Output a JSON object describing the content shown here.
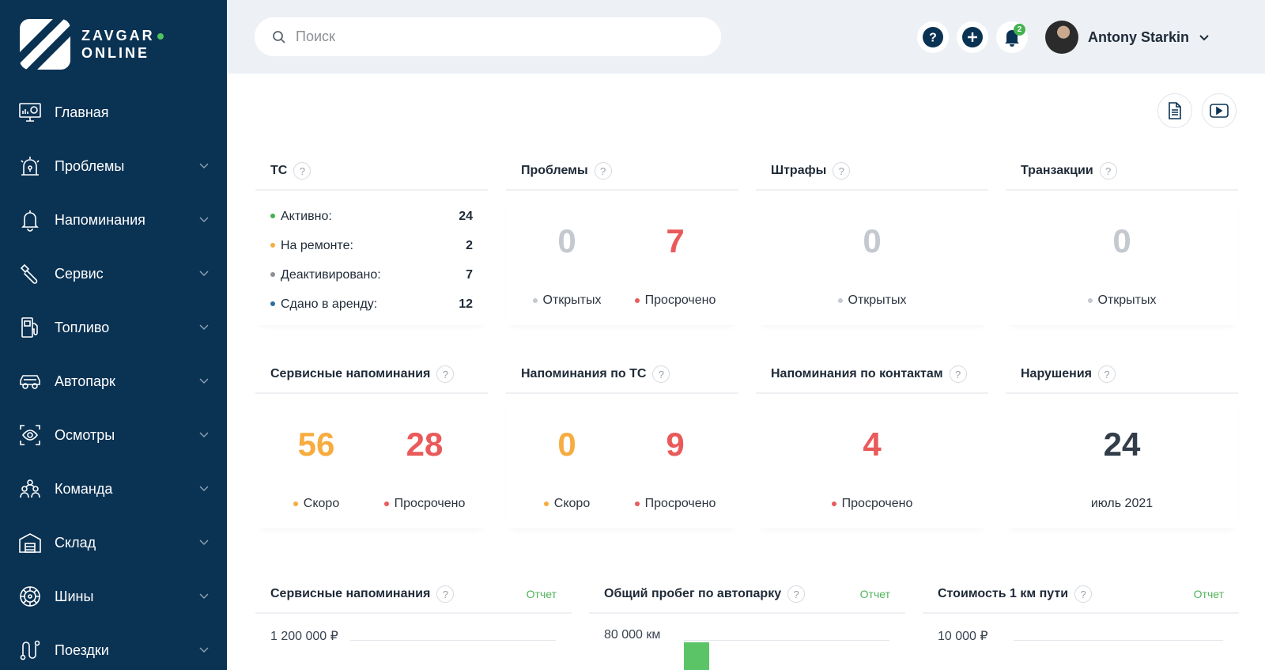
{
  "brand": {
    "line1": "ZAVGAR",
    "line2": "ONLINE",
    "accent": "#4fc45e",
    "sidebar_bg": "#0a3253"
  },
  "sidebar": {
    "items": [
      {
        "label": "Главная",
        "icon": "dashboard-icon"
      },
      {
        "label": "Проблемы",
        "icon": "alarm-icon"
      },
      {
        "label": "Напоминания",
        "icon": "bell-icon"
      },
      {
        "label": "Сервис",
        "icon": "wrench-icon"
      },
      {
        "label": "Топливо",
        "icon": "fuel-icon"
      },
      {
        "label": "Автопарк",
        "icon": "car-icon"
      },
      {
        "label": "Осмотры",
        "icon": "eye-icon"
      },
      {
        "label": "Команда",
        "icon": "team-icon"
      },
      {
        "label": "Склад",
        "icon": "warehouse-icon"
      },
      {
        "label": "Шины",
        "icon": "tire-icon"
      },
      {
        "label": "Поездки",
        "icon": "route-icon"
      }
    ]
  },
  "header": {
    "search_placeholder": "Поиск",
    "notifications_count": "2",
    "user_name": "Antony Starkin"
  },
  "cards_row1": {
    "ts": {
      "title": "ТС",
      "rows": [
        {
          "label": "Активно:",
          "value": "24",
          "color": "#44b24f"
        },
        {
          "label": "На ремонте:",
          "value": "2",
          "color": "#f7ac3f"
        },
        {
          "label": "Деактивировано:",
          "value": "7",
          "color": "#8b9096"
        },
        {
          "label": "Сдано в аренду:",
          "value": "12",
          "color": "#2f6f9f"
        }
      ]
    },
    "problems": {
      "title": "Проблемы",
      "open_value": "0",
      "open_label": "Открытых",
      "overdue_value": "7",
      "overdue_label": "Просрочено"
    },
    "fines": {
      "title": "Штрафы",
      "open_value": "0",
      "open_label": "Открытых"
    },
    "transactions": {
      "title": "Транзакции",
      "open_value": "0",
      "open_label": "Открытых"
    }
  },
  "cards_row2": {
    "service_reminders": {
      "title": "Сервисные напоминания",
      "soon_value": "56",
      "soon_label": "Скоро",
      "overdue_value": "28",
      "overdue_label": "Просрочено"
    },
    "vehicle_reminders": {
      "title": "Напоминания по ТС",
      "soon_value": "0",
      "soon_label": "Скоро",
      "overdue_value": "9",
      "overdue_label": "Просрочено"
    },
    "contact_reminders": {
      "title": "Напоминания по контактам",
      "overdue_value": "4",
      "overdue_label": "Просрочено"
    },
    "violations": {
      "title": "Нарушения",
      "value": "24",
      "period": "июль 2021"
    }
  },
  "charts": [
    {
      "title": "Сервисные напоминания",
      "report": "Отчет",
      "axis_top": "1 200 000 ₽"
    },
    {
      "title": "Общий пробег по автопарку",
      "report": "Отчет",
      "axis_top": "80 000 км"
    },
    {
      "title": "Стоимость 1 км пути",
      "report": "Отчет",
      "axis_top": "10 000 ₽"
    }
  ],
  "colors": {
    "orange": "#f7ac3f",
    "red": "#ea5a5a",
    "green": "#44b24f",
    "gray": "#c3c9cf"
  }
}
